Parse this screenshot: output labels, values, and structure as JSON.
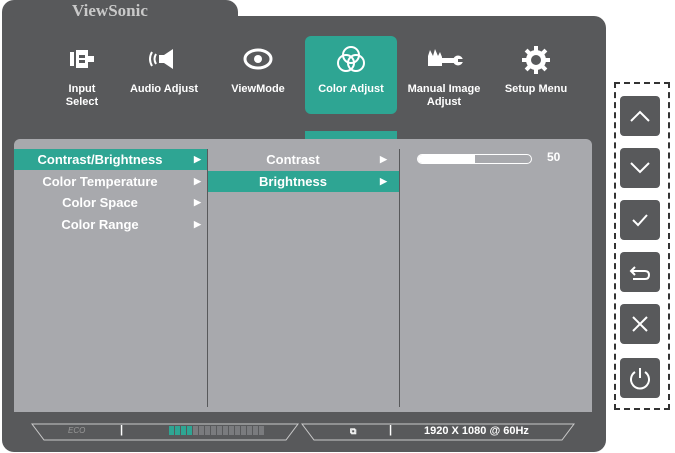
{
  "brand": "ViewSonic",
  "nav": [
    {
      "label1": "Input",
      "label2": "Select",
      "icon": "input-select-icon"
    },
    {
      "label1": "Audio Adjust",
      "label2": "",
      "icon": "audio-adjust-icon"
    },
    {
      "label1": "ViewMode",
      "label2": "",
      "icon": "eye-icon"
    },
    {
      "label1": "Color Adjust",
      "label2": "",
      "icon": "color-circles-icon",
      "active": true
    },
    {
      "label1": "Manual Image",
      "label2": "Adjust",
      "icon": "manual-image-adjust-icon"
    },
    {
      "label1": "Setup Menu",
      "label2": "",
      "icon": "gear-icon"
    }
  ],
  "menu1": [
    "Contrast/Brightness",
    "Color Temperature",
    "Color Space",
    "Color Range"
  ],
  "menu2": [
    "Contrast",
    "Brightness"
  ],
  "slider": {
    "value": "50",
    "fraction": 0.5
  },
  "status": {
    "eco": "ECO",
    "resolution": "1920 X 1080 @ 60Hz"
  },
  "keys": [
    "up-key",
    "down-key",
    "confirm-key",
    "return-key",
    "close-key",
    "power-key"
  ],
  "colors": {
    "accent": "#2ea593",
    "osd": "#58595b",
    "panel": "#a8a9ad"
  }
}
